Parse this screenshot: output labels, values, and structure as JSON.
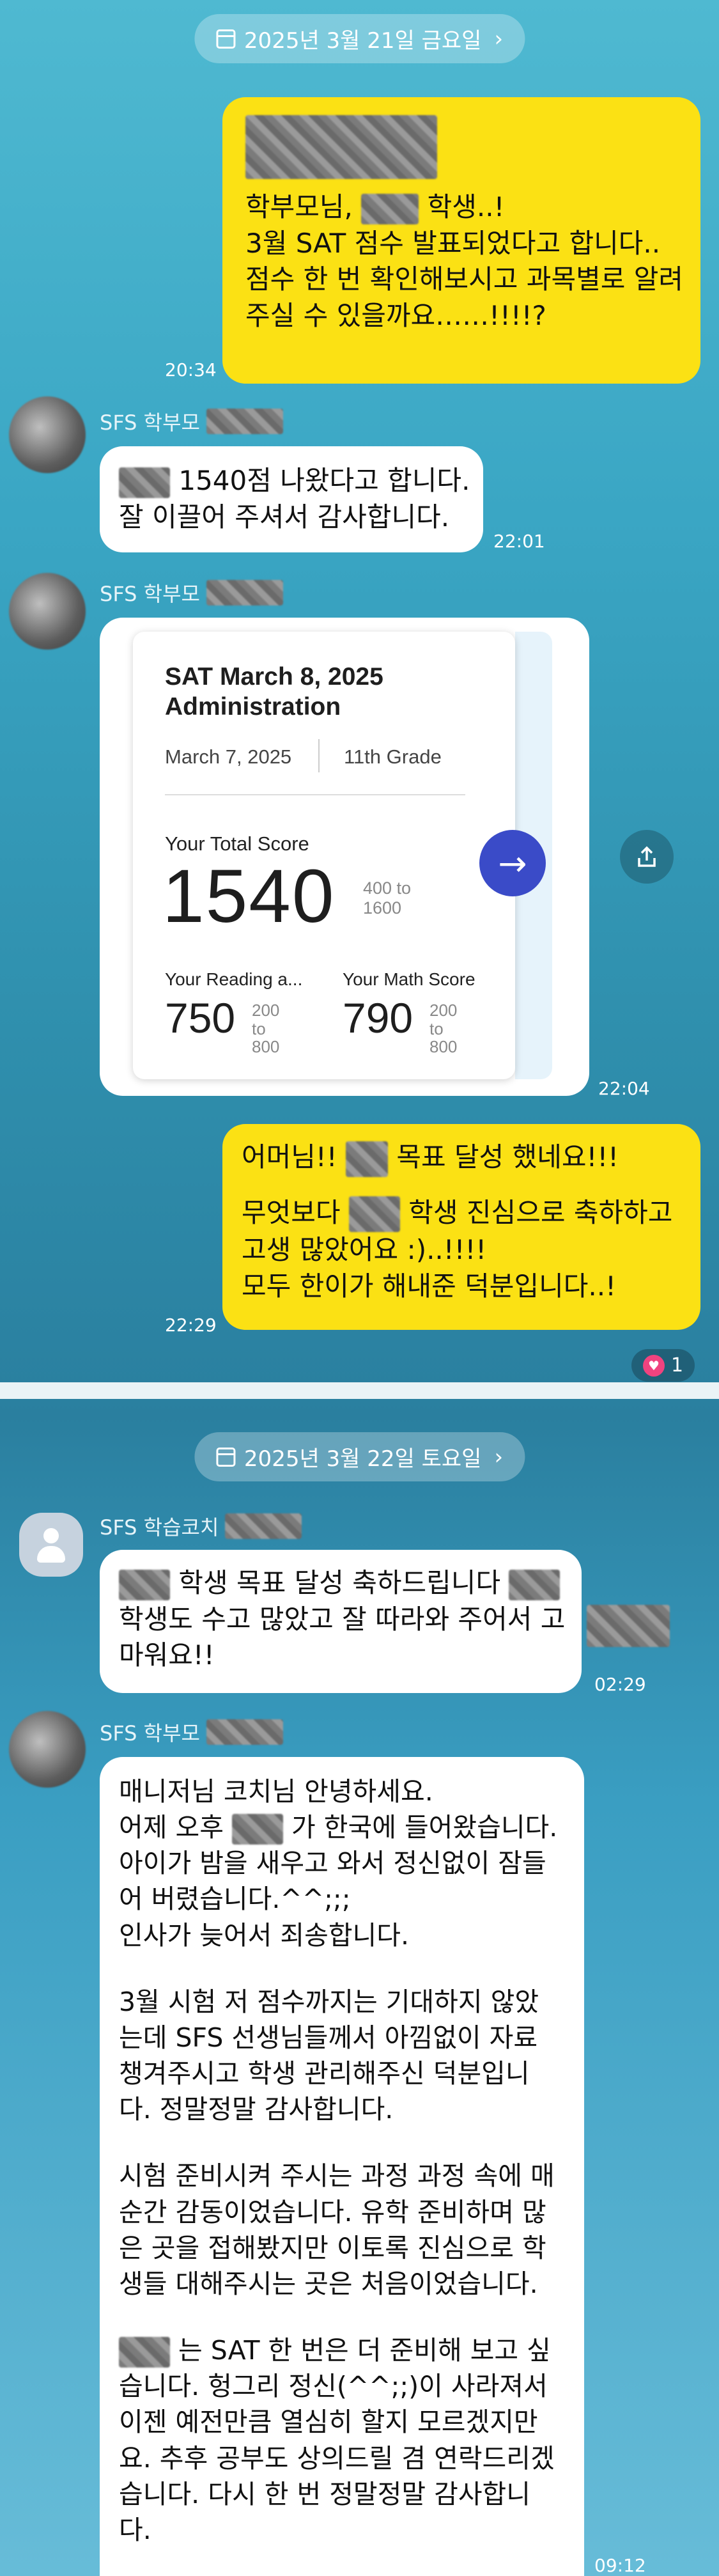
{
  "section1": {
    "date_label": "2025년 3월 21일 금요일",
    "msg1": {
      "lines": [
        "학부모님,",
        "학생..!",
        "3월 SAT 점수 발표되었다고 합니다..",
        "점수 한 번 확인해보시고 과목별로 알려",
        "주실 수 있을까요……!!!!?"
      ],
      "time": "20:34"
    },
    "sender_parent": "SFS 학부모",
    "msg2": {
      "lines": [
        "1540점 나왔다고 합니다.",
        "잘 이끌어 주셔서 감사합니다."
      ],
      "time": "22:01"
    },
    "msg3_time": "22:04",
    "score_card": {
      "title": "SAT March 8, 2025 Administration",
      "date": "March 7, 2025",
      "grade": "11th Grade",
      "total_label": "Your Total Score",
      "total": "1540",
      "total_range": "400 to 1600",
      "reading_label": "Your Reading a...",
      "reading": "750",
      "reading_range": "200 to 800",
      "math_label": "Your Math Score",
      "math": "790",
      "math_range": "200 to 800"
    },
    "msg4": {
      "line1": "어머님!!",
      "line1b": "목표 달성 했네요!!!",
      "line2a": "무엇보다",
      "line2b": "학생 진심으로 축하하고",
      "line3": "고생 많았어요 :)..!!!!",
      "line4": "모두 한이가 해내준 덕분입니다..!",
      "time": "22:29"
    },
    "reaction_count": "1"
  },
  "section2": {
    "date_label": "2025년 3월 22일 토요일",
    "sender_coach": "SFS 학습코치",
    "coach_msg": {
      "line1b": "학생 목표 달성 축하드립니다",
      "line2": "학생도 수고 많았고 잘 따라와 주어서 고",
      "line3": "마워요!!",
      "time": "02:29"
    },
    "sender_parent": "SFS 학부모",
    "parent_msg": {
      "p1": [
        "매니저님 코치님 안녕하세요.",
        "어제 오후",
        "가 한국에 들어왔습니다.",
        "아이가 밤을 새우고 와서 정신없이 잠들",
        "어 버렸습니다.^^;;;",
        "인사가 늦어서 죄송합니다."
      ],
      "p2": [
        "3월 시험 저 점수까지는 기대하지 않았",
        "는데 SFS 선생님들께서 아낌없이 자료",
        "챙겨주시고 학생 관리해주신 덕분입니",
        "다. 정말정말 감사합니다."
      ],
      "p3": [
        "시험 준비시켜 주시는 과정 과정 속에 매",
        "순간 감동이었습니다. 유학 준비하며 많",
        "은 곳을 접해봤지만 이토록 진심으로 학",
        "생들 대해주시는 곳은 처음이었습니다."
      ],
      "p4": [
        "는 SAT 한 번은 더 준비해 보고 싶",
        "습니다. 헝그리 정신(^^;;)이 사라져서",
        "이젠 예전만큼 열심히 할지 모르겠지만",
        "요. 추후 공부도 상의드릴 겸 연락드리겠",
        "습니다. 다시 한 번 정말정말 감사합니",
        "다."
      ],
      "time": "09:12"
    }
  },
  "colors": {
    "my_bubble": "#fbe114",
    "their_bubble": "#ffffff",
    "arrow_button": "#3a4bc8"
  }
}
